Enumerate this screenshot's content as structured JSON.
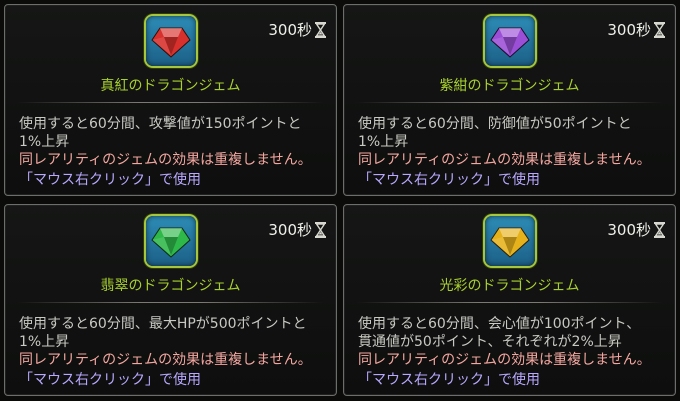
{
  "items": [
    {
      "name": "真紅のドラゴンジェム",
      "cooldown": "300秒",
      "icon": "red-gem-icon",
      "gem_color": "#d8302c",
      "description": "使用すると60分間、攻撃値が150ポイントと\n1%上昇",
      "warning": "同レアリティのジェムの効果は重複しません。",
      "usage": "「マウス右クリック」で使用"
    },
    {
      "name": "紫紺のドラゴンジェム",
      "cooldown": "300秒",
      "icon": "purple-gem-icon",
      "gem_color": "#9b4fd6",
      "description": "使用すると60分間、防御値が50ポイントと\n1%上昇",
      "warning": "同レアリティのジェムの効果は重複しません。",
      "usage": "「マウス右クリック」で使用"
    },
    {
      "name": "翡翠のドラゴンジェム",
      "cooldown": "300秒",
      "icon": "green-gem-icon",
      "gem_color": "#2fb84a",
      "description": "使用すると60分間、最大HPが500ポイントと\n1%上昇",
      "warning": "同レアリティのジェムの効果は重複しません。",
      "usage": "「マウス右クリック」で使用"
    },
    {
      "name": "光彩のドラゴンジェム",
      "cooldown": "300秒",
      "icon": "yellow-gem-icon",
      "gem_color": "#e6b21c",
      "description": "使用すると60分間、会心値が100ポイント、\n貫通値が50ポイント、それぞれが2%上昇",
      "warning": "同レアリティのジェムの効果は重複しません。",
      "usage": "「マウス右クリック」で使用"
    }
  ],
  "colors": {
    "name_text": "#a8d12e",
    "warning_text": "#f4a6a0",
    "usage_text": "#b9a8ff",
    "icon_border": "#a7c63a"
  }
}
